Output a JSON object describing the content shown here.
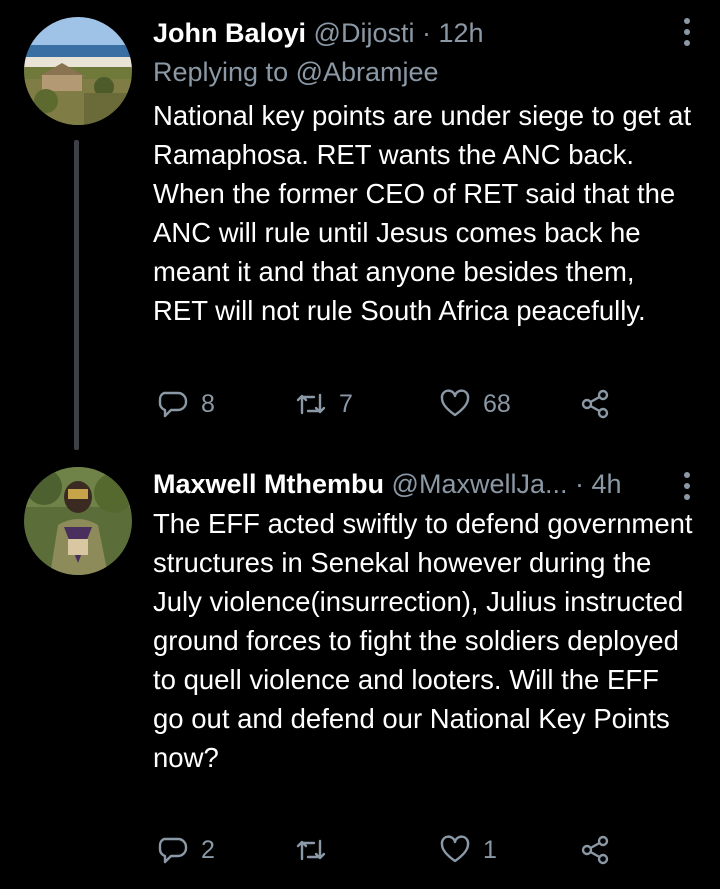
{
  "tweets": [
    {
      "name": "John Baloyi",
      "handle": "@Dijosti",
      "separator": "·",
      "time": "12h",
      "replying_label": "Replying to",
      "replying_to": "@Abramjee",
      "text": "National key points are under siege to get at Ramaphosa. RET wants the ANC back. When the former CEO of RET said that the ANC will rule until Jesus comes back he meant it and that anyone besides them, RET will not rule South Africa peacefully.",
      "replies": "8",
      "retweets": "7",
      "likes": "68"
    },
    {
      "name": "Maxwell Mthembu",
      "handle": "@MaxwellJa...",
      "separator": "·",
      "time": "4h",
      "text": "The EFF acted swiftly to defend government structures in Senekal however during the July violence(insurrection), Julius instructed ground forces to fight the soldiers deployed to quell violence and looters. Will the EFF go out and defend our National Key Points now?",
      "replies": "2",
      "retweets": "",
      "likes": "1"
    }
  ],
  "icons": {
    "reply": "reply-icon",
    "retweet": "retweet-icon",
    "like": "heart-icon",
    "share": "share-icon",
    "more": "more-icon"
  },
  "colors": {
    "background": "#000000",
    "secondary_text": "#8b98a5",
    "thread_line": "#3d4145"
  }
}
